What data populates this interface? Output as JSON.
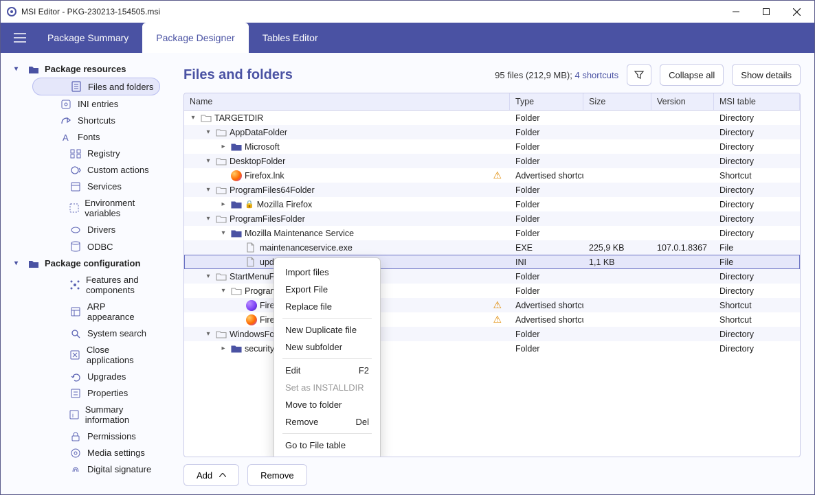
{
  "window": {
    "title": "MSI Editor - PKG-230213-154505.msi"
  },
  "tabs": {
    "summary": "Package Summary",
    "designer": "Package Designer",
    "tables": "Tables Editor"
  },
  "sidebar": {
    "group_resources": "Package resources",
    "group_config": "Package configuration",
    "res": {
      "files": "Files and folders",
      "ini": "INI entries",
      "shortcuts": "Shortcuts",
      "fonts": "Fonts",
      "registry": "Registry",
      "custom": "Custom actions",
      "services": "Services",
      "env": "Environment variables",
      "drivers": "Drivers",
      "odbc": "ODBC"
    },
    "cfg": {
      "features": "Features and components",
      "arp": "ARP appearance",
      "search": "System search",
      "close": "Close applications",
      "upgrades": "Upgrades",
      "props": "Properties",
      "summary": "Summary information",
      "perms": "Permissions",
      "media": "Media settings",
      "sig": "Digital signature"
    }
  },
  "main": {
    "title": "Files and folders",
    "stats_files": "95 files (212,9 MB); ",
    "stats_shortcuts": "4 shortcuts",
    "collapse": "Collapse all",
    "show_details": "Show details"
  },
  "columns": {
    "name": "Name",
    "type": "Type",
    "size": "Size",
    "version": "Version",
    "table": "MSI table"
  },
  "rows": [
    {
      "indent": 0,
      "exp": "open",
      "icon": "folder-gray",
      "name": "TARGETDIR",
      "type": "Folder",
      "size": "",
      "ver": "",
      "tbl": "Directory"
    },
    {
      "indent": 1,
      "exp": "open",
      "icon": "folder-gray",
      "name": "AppDataFolder",
      "type": "Folder",
      "size": "",
      "ver": "",
      "tbl": "Directory"
    },
    {
      "indent": 2,
      "exp": "closed",
      "icon": "folder-blue",
      "name": "Microsoft",
      "type": "Folder",
      "size": "",
      "ver": "",
      "tbl": "Directory"
    },
    {
      "indent": 1,
      "exp": "open",
      "icon": "folder-gray",
      "name": "DesktopFolder",
      "type": "Folder",
      "size": "",
      "ver": "",
      "tbl": "Directory"
    },
    {
      "indent": 2,
      "exp": "none",
      "icon": "firefox",
      "name": "Firefox.lnk",
      "type": "Advertised shortcut",
      "size": "",
      "ver": "",
      "tbl": "Shortcut",
      "warn": true
    },
    {
      "indent": 1,
      "exp": "open",
      "icon": "folder-gray",
      "name": "ProgramFiles64Folder",
      "type": "Folder",
      "size": "",
      "ver": "",
      "tbl": "Directory"
    },
    {
      "indent": 2,
      "exp": "closed",
      "icon": "folder-blue",
      "name": "Mozilla Firefox",
      "type": "Folder",
      "size": "",
      "ver": "",
      "tbl": "Directory",
      "lock": true
    },
    {
      "indent": 1,
      "exp": "open",
      "icon": "folder-gray",
      "name": "ProgramFilesFolder",
      "type": "Folder",
      "size": "",
      "ver": "",
      "tbl": "Directory"
    },
    {
      "indent": 2,
      "exp": "open",
      "icon": "folder-blue",
      "name": "Mozilla Maintenance Service",
      "type": "Folder",
      "size": "",
      "ver": "",
      "tbl": "Directory"
    },
    {
      "indent": 3,
      "exp": "none",
      "icon": "file",
      "name": "maintenanceservice.exe",
      "type": "EXE",
      "size": "225,9 KB",
      "ver": "107.0.1.8367",
      "tbl": "File"
    },
    {
      "indent": 3,
      "exp": "none",
      "icon": "file",
      "name": "updater.ini",
      "type": "INI",
      "size": "1,1 KB",
      "ver": "",
      "tbl": "File",
      "selected": true
    },
    {
      "indent": 1,
      "exp": "open",
      "icon": "folder-gray",
      "name": "StartMenuFolder",
      "type": "Folder",
      "size": "",
      "ver": "",
      "tbl": "Directory"
    },
    {
      "indent": 2,
      "exp": "open",
      "icon": "folder-gray",
      "name": "ProgramMenuFolder",
      "type": "Folder",
      "size": "",
      "ver": "",
      "tbl": "Directory"
    },
    {
      "indent": 3,
      "exp": "none",
      "icon": "firefox-priv",
      "name": "Firefox Private Browsing.lnk",
      "type": "Advertised shortcut",
      "size": "",
      "ver": "",
      "tbl": "Shortcut",
      "warn": true
    },
    {
      "indent": 3,
      "exp": "none",
      "icon": "firefox",
      "name": "Firefox.lnk",
      "type": "Advertised shortcut",
      "size": "",
      "ver": "",
      "tbl": "Shortcut",
      "warn": true
    },
    {
      "indent": 1,
      "exp": "open",
      "icon": "folder-gray",
      "name": "WindowsFolder",
      "type": "Folder",
      "size": "",
      "ver": "",
      "tbl": "Directory"
    },
    {
      "indent": 2,
      "exp": "closed",
      "icon": "folder-blue",
      "name": "security",
      "type": "Folder",
      "size": "",
      "ver": "",
      "tbl": "Directory"
    }
  ],
  "ctx": {
    "import": "Import files",
    "export": "Export File",
    "replace": "Replace file",
    "dup": "New Duplicate file",
    "sub": "New subfolder",
    "edit": "Edit",
    "edit_key": "F2",
    "installdir": "Set as INSTALLDIR",
    "move": "Move to folder",
    "remove": "Remove",
    "remove_key": "Del",
    "goto": "Go to File table"
  },
  "footer": {
    "add": "Add",
    "remove": "Remove"
  }
}
